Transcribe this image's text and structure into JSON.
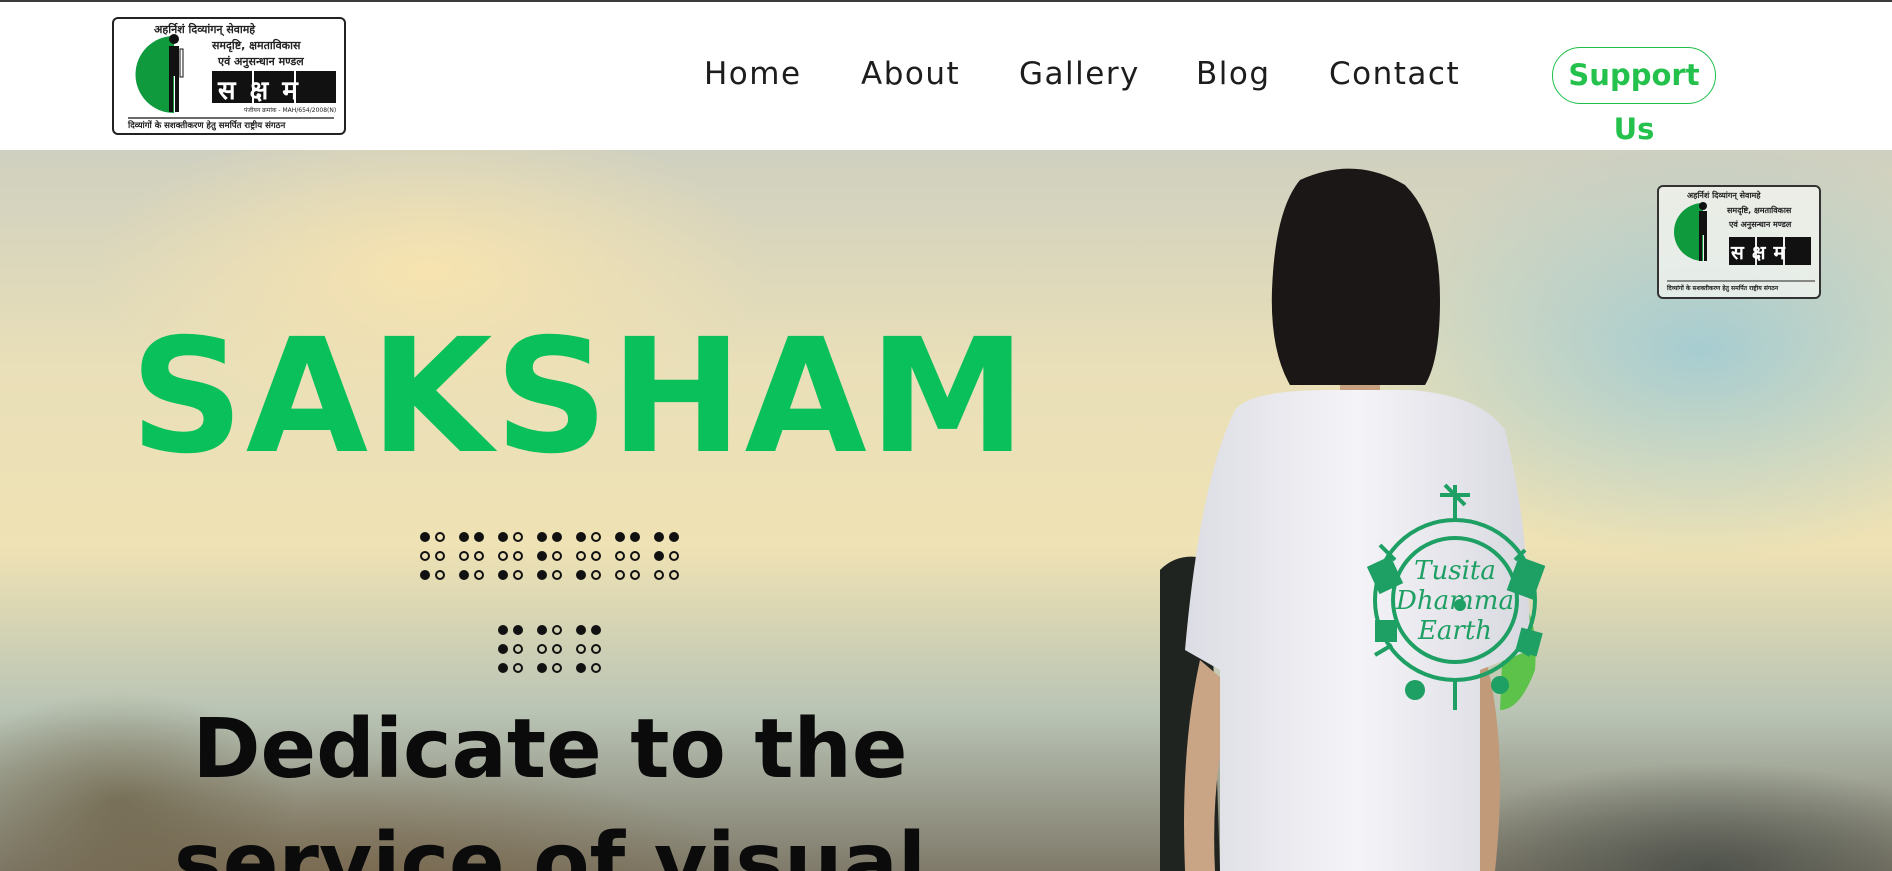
{
  "header": {
    "logo": {
      "line1": "अहर्निशं दिव्यांगन् सेवामहे",
      "line2": "समदृष्टि, क्षमताविकास",
      "line3": "एवं अनुसन्धान मण्डल",
      "mark": "सक्षम",
      "reg": "पंजीयन क्रमांक - MAH/654/2008(N)",
      "bottom": "दिव्यांगों के सशक्तीकरण हेतु समर्पित राष्ट्रीय संगठन"
    },
    "nav": [
      "Home",
      "About",
      "Gallery",
      "Blog",
      "Contact"
    ],
    "support_label": "Support Us"
  },
  "hero": {
    "title": "SAKSHAM",
    "tagline_line1": "Dedicate to the",
    "tagline_line2": "service of visual",
    "shirt_text": [
      "Tusita",
      "Dhamma",
      "Earth"
    ],
    "braille_row1": [
      [
        1,
        0,
        1,
        0,
        0,
        0
      ],
      [
        1,
        0,
        1,
        1,
        0,
        0
      ],
      [
        1,
        0,
        1,
        0,
        0,
        0
      ],
      [
        1,
        1,
        1,
        1,
        0,
        0
      ],
      [
        1,
        0,
        1,
        0,
        0,
        0
      ],
      [
        1,
        0,
        0,
        1,
        0,
        0
      ],
      [
        1,
        1,
        0,
        1,
        0,
        0
      ]
    ],
    "braille_row2": [
      [
        1,
        1,
        1,
        1,
        0,
        0
      ],
      [
        1,
        0,
        1,
        0,
        0,
        0
      ],
      [
        1,
        0,
        1,
        1,
        0,
        0
      ]
    ]
  },
  "colors": {
    "brand_green": "#09c05b",
    "support_green": "#24c24c",
    "text_dark": "#1d1d1d"
  }
}
